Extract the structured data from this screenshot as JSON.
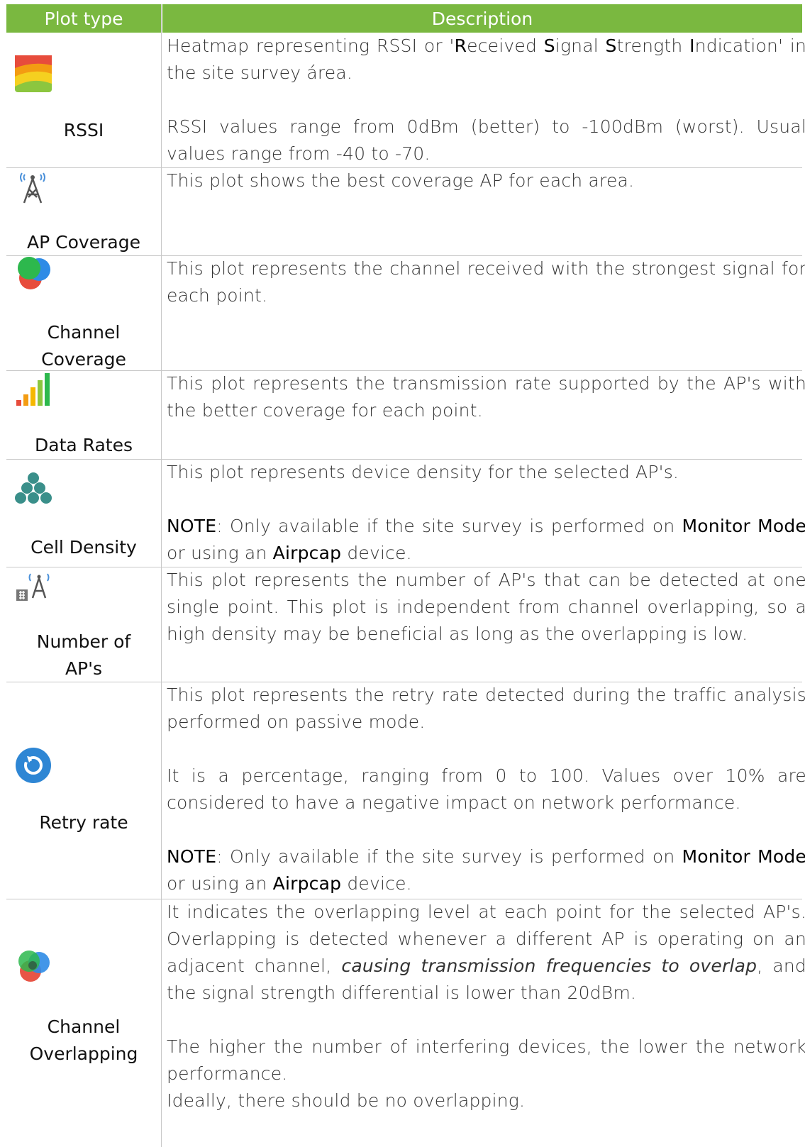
{
  "header": {
    "plot_type": "Plot type",
    "description": "Description"
  },
  "rows": [
    {
      "name": "RSSI",
      "icon": "rssi-heatmap-icon",
      "desc": [
        {
          "parts": [
            {
              "t": "Heatmap representing RSSI or '"
            },
            {
              "t": "R",
              "b": true
            },
            {
              "t": "eceived "
            },
            {
              "t": "S",
              "b": true
            },
            {
              "t": "ignal "
            },
            {
              "t": "S",
              "b": true
            },
            {
              "t": "trength "
            },
            {
              "t": "I",
              "b": true
            },
            {
              "t": "ndication' in the site survey área."
            }
          ]
        },
        {
          "parts": [
            {
              "t": "RSSI values range from 0dBm (better) to -100dBm (worst). Usual values range from -40 to -70."
            }
          ]
        }
      ]
    },
    {
      "name": "AP Coverage",
      "icon": "antenna-tower-icon",
      "desc": [
        {
          "parts": [
            {
              "t": "This plot shows the best coverage AP for each area."
            }
          ]
        }
      ]
    },
    {
      "name": "Channel Coverage",
      "icon": "channel-circles-icon",
      "desc": [
        {
          "parts": [
            {
              "t": "This plot represents the channel received with the strongest signal for each point."
            }
          ]
        }
      ]
    },
    {
      "name": "Data Rates",
      "icon": "signal-bars-icon",
      "desc": [
        {
          "parts": [
            {
              "t": "This plot represents the transmission rate supported by the AP's with the better coverage for each point."
            }
          ]
        }
      ]
    },
    {
      "name": "Cell Density",
      "icon": "hexagon-cluster-icon",
      "desc": [
        {
          "parts": [
            {
              "t": "This plot represents device density for the selected AP's."
            }
          ]
        },
        {
          "parts": [
            {
              "t": "NOTE",
              "b": true
            },
            {
              "t": ": Only available if the site survey is performed on "
            },
            {
              "t": "Monitor Mode",
              "b": true
            },
            {
              "t": " or using an "
            },
            {
              "t": "Airpcap",
              "b": true
            },
            {
              "t": " device."
            }
          ]
        }
      ]
    },
    {
      "name": "Number of AP's",
      "icon": "ap-count-icon",
      "desc": [
        {
          "parts": [
            {
              "t": "This plot represents the number of AP's that can be detected at one single point. This plot is independent from channel overlapping, so a high density may be beneficial as long as the overlapping is low."
            }
          ]
        }
      ]
    },
    {
      "name": "Retry rate",
      "icon": "retry-circle-icon",
      "desc": [
        {
          "parts": [
            {
              "t": "This plot represents the retry rate detected during the traffic analysis performed on passive mode."
            }
          ]
        },
        {
          "parts": [
            {
              "t": "It is a percentage, ranging from 0 to 100. Values over 10% are considered to have a negative impact on network performance."
            }
          ]
        },
        {
          "parts": [
            {
              "t": "NOTE",
              "b": true
            },
            {
              "t": ": Only available if the site survey is performed on "
            },
            {
              "t": "Monitor Mode",
              "b": true
            },
            {
              "t": " or using an "
            },
            {
              "t": "Airpcap",
              "b": true
            },
            {
              "t": " device."
            }
          ]
        }
      ]
    },
    {
      "name": "Channel Overlapping",
      "icon": "overlap-circles-icon",
      "desc": [
        {
          "parts": [
            {
              "t": "It indicates the overlapping level at each point for the selected AP's. Overlapping is detected whenever a different AP is operating on an adjacent channel, "
            },
            {
              "t": "causing transmission frequencies to overlap",
              "i": true
            },
            {
              "t": ", and the signal strength differential is lower than 20dBm."
            }
          ]
        },
        {
          "parts": [
            {
              "t": "The higher the number of interfering devices, the lower the network performance."
            },
            {
              "t": "\nIdeally, there should be no overlapping."
            }
          ]
        }
      ]
    }
  ]
}
